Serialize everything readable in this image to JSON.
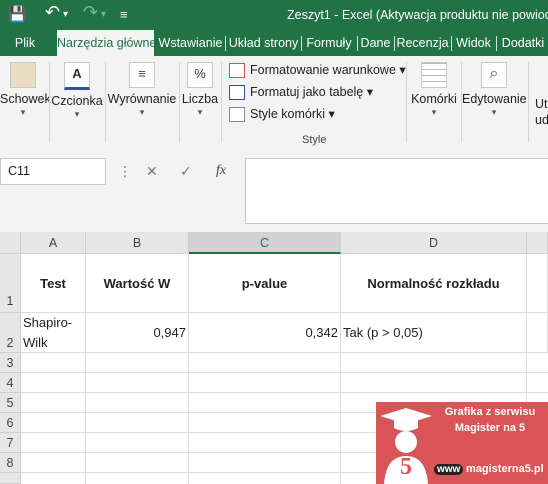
{
  "window": {
    "title": "Zeszyt1 - Excel (Aktywacja produktu nie powiodła"
  },
  "quick_access": {
    "save_glyph": "💾",
    "undo_glyph": "↶",
    "undo_menu_glyph": "▾",
    "redo_glyph": "↷",
    "redo_menu_glyph": "▾",
    "customize_glyph": "≡"
  },
  "tabs": [
    "Plik",
    "Narzędzia główne",
    "Wstawianie",
    "Układ strony",
    "Formuły",
    "Dane",
    "Recenzja",
    "Widok",
    "Dodatki"
  ],
  "active_tab": "Narzędzia główne",
  "ribbon": {
    "buttons": [
      "Schowek",
      "Czcionka",
      "Wyrównanie",
      "Liczba"
    ],
    "style_items": [
      "Formatowanie warunkowe ▾",
      "Formatuj jako tabelę ▾",
      "Style komórki ▾"
    ],
    "style_group_label": "Style",
    "cells_button": "Komórki",
    "editing_button": "Edytowanie",
    "extra_button_line1": "Ut",
    "extra_button_line2": "ud",
    "dropdown_glyph": "▾",
    "font_glyph": "A",
    "percent_glyph": "%",
    "align_glyph": "≡",
    "find_glyph": "⌕"
  },
  "formula_bar": {
    "name_box": "C11",
    "more_glyph": "⋮",
    "cancel_glyph": "✕",
    "enter_glyph": "✓",
    "fx_label": "fx",
    "formula": ""
  },
  "sheet": {
    "columns": [
      "A",
      "B",
      "C",
      "D"
    ],
    "selected_column": "C",
    "row_numbers": [
      "1",
      "2",
      "3",
      "4",
      "5",
      "6",
      "7",
      "8"
    ],
    "header_row": [
      "Test",
      "Wartość W",
      "p-value",
      "Normalność rozkładu"
    ],
    "data_row": [
      "Shapiro-Wilk",
      "0,947",
      "0,342",
      "Tak (p > 0,05)"
    ]
  },
  "watermark": {
    "line1": "Grafika z serwisu",
    "line2": "Magister na 5",
    "digit": "5",
    "www": "www",
    "url": "magisterna5.pl"
  },
  "colors": {
    "excel_green": "#217346",
    "watermark_red": "#d95456"
  }
}
